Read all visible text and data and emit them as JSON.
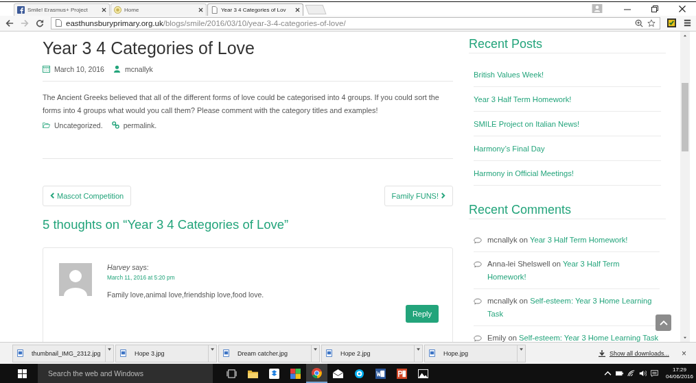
{
  "tabs": [
    {
      "label": "Smile! Erasmus+ Project",
      "kind": "facebook",
      "selected": false
    },
    {
      "label": "Home",
      "kind": "site",
      "selected": false
    },
    {
      "label": "Year 3 4 Categories of Lov",
      "kind": "page",
      "selected": true
    }
  ],
  "address": {
    "host": "easthunsburyprimary.org.uk",
    "path": "/blogs/smile/2016/03/10/year-3-4-categories-of-love/"
  },
  "post": {
    "title": "Year 3 4 Categories of Love",
    "date": "March 10, 2016",
    "author": "mcnallyk",
    "body": "The Ancient Greeks believed that all of the different forms of love could be categorised into 4 groups. If you could sort the forms into 4 groups what would you call them? Please comment with the category titles and examples!",
    "category": "Uncategorized.",
    "permalink": "permalink."
  },
  "post_nav": {
    "previous": "Mascot Competition",
    "next": "Family FUNS!"
  },
  "comments": {
    "title": "5 thoughts on “Year 3 4 Categories of Love”",
    "items": [
      {
        "author": "Harvey",
        "says": "says:",
        "date": "March 11, 2016 at 5:20 pm",
        "text": "Family love,animal love,friendship love,food love.",
        "reply": "Reply"
      }
    ]
  },
  "sidebar": {
    "recent_posts": {
      "title": "Recent Posts",
      "items": [
        "British Values Week!",
        "Year 3 Half Term Homework!",
        "SMILE Project on Italian News!",
        "Harmony’s Final Day",
        "Harmony in Official Meetings!"
      ]
    },
    "recent_comments": {
      "title": "Recent Comments",
      "items": [
        {
          "author": "mcnallyk",
          "on": "on",
          "post": "Year 3 Half Term Homework!"
        },
        {
          "author": "Anna-lei Shelswell",
          "on": "on",
          "post": "Year 3 Half Term Homework!"
        },
        {
          "author": "mcnallyk",
          "on": "on",
          "post": "Self-esteem: Year 3 Home Learning Task"
        },
        {
          "author": "Emily",
          "on": "on",
          "post": "Self-esteem: Year 3 Home Learning Task"
        }
      ]
    }
  },
  "downloads": {
    "items": [
      "thumbnail_IMG_2312.jpg",
      "Hope 3.jpg",
      "Dream catcher.jpg",
      "Hope 2.jpg",
      "Hope.jpg"
    ],
    "show_all": "Show all downloads...",
    "close": "×"
  },
  "taskbar": {
    "search_placeholder": "Search the web and Windows",
    "time": "17:29",
    "date": "04/06/2016"
  }
}
